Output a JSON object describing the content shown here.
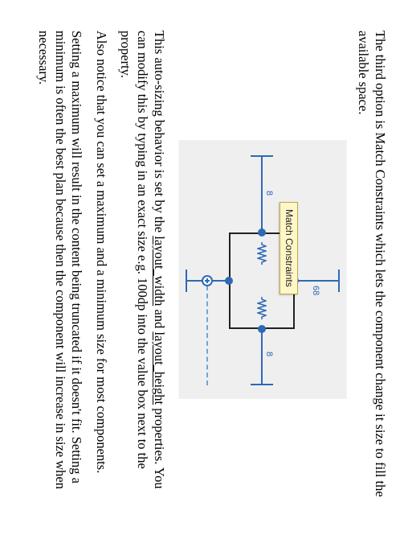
{
  "paragraphs": {
    "p1": "The third option is Match Constraints which lets the component change it size to fill the available space.",
    "p2_pre": "This auto-sizing behavior is set by the ",
    "p2_u1": "layout_width",
    "p2_mid": " and ",
    "p2_u2": "layout_height",
    "p2_post": " properties. You can modify this by typing in an exact size e.g. 100dp into the value box next to the property.",
    "p3": "Also notice that you can set a maximum and a minimum size for most components.",
    "p4": "Setting a maximum will result in the content being truncated if it doesn't fit. Setting a minimum is often the best plan because then the component will increase in size when necessary."
  },
  "figure": {
    "tooltip": "Match Constraints",
    "dim_top": "68",
    "dim_left": "8",
    "dim_right": "8"
  }
}
